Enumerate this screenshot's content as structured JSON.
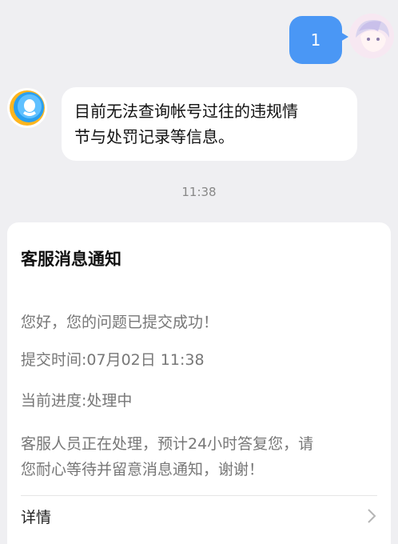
{
  "messages": {
    "outgoing_text": "1",
    "incoming_text_line1": "目前无法查询帐号过往的违规情",
    "incoming_text_line2": "节与处罚记录等信息。"
  },
  "timestamp": "11:38",
  "card": {
    "title": "客服消息通知",
    "greeting": "您好，您的问题已提交成功！",
    "submit_time": "提交时间:07月02日 11:38",
    "progress": "当前进度:处理中",
    "note_line1": "客服人员正在处理，预计24小时答复您，请",
    "note_line2": "您耐心等待并留意消息通知，谢谢！",
    "details_label": "详情"
  },
  "colors": {
    "accent_blue": "#4a97f5",
    "background": "#efeff2"
  },
  "icons": {
    "user_avatar": "user-avatar",
    "bot_avatar": "qq-service-avatar",
    "chevron": "chevron-right-icon"
  }
}
